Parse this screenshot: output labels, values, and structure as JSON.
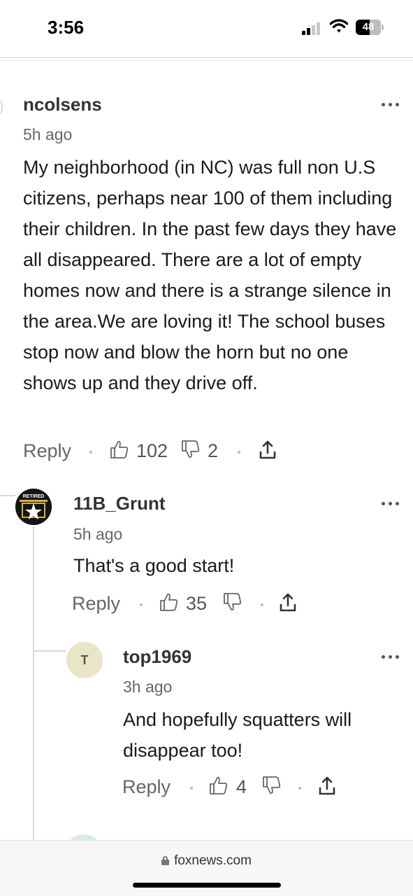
{
  "status_bar": {
    "time": "3:56",
    "battery": "48"
  },
  "comments": [
    {
      "username": "ncolsens",
      "timestamp": "5h ago",
      "text": "My neighborhood (in NC) was full non U.S citizens, perhaps near 100 of them including their children. In the past few days they have all disappeared. There are a lot of empty homes now and there is a strange silence in the area.We are loving it! The school buses stop now and blow the horn but no one shows up and they drive off.",
      "reply_label": "Reply",
      "likes": "102",
      "dislikes": "2"
    },
    {
      "username": "11B_Grunt",
      "timestamp": "5h ago",
      "avatar_badge_text": "RETIRED",
      "text": "That's a good start!",
      "reply_label": "Reply",
      "likes": "35",
      "dislikes": ""
    },
    {
      "username": "top1969",
      "timestamp": "3h ago",
      "avatar_letter": "T",
      "text": "And hopefully squatters will disappear too!",
      "reply_label": "Reply",
      "likes": "4",
      "dislikes": ""
    }
  ],
  "browser": {
    "url": "foxnews.com"
  },
  "icons": {
    "more": "more-options-icon",
    "like": "thumbs-up-icon",
    "dislike": "thumbs-down-icon",
    "share": "share-icon",
    "lock": "lock-icon"
  }
}
